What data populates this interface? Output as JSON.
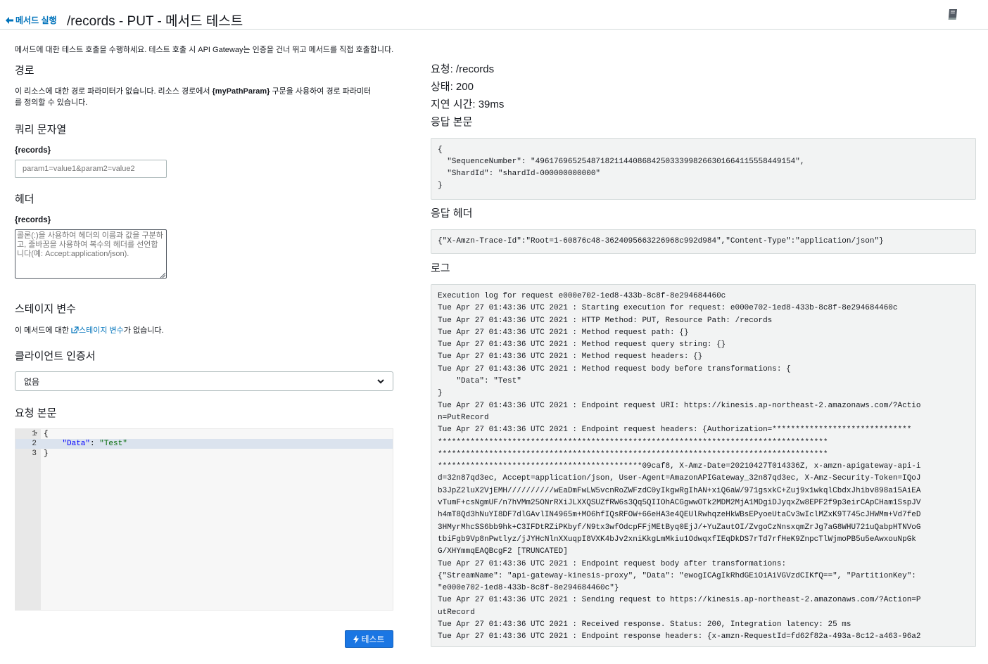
{
  "header": {
    "back_label": "메서드 실행",
    "title": "/records - PUT - 메서드 테스트"
  },
  "left": {
    "intro": "메서드에 대한 테스트 호출을 수행하세요. 테스트 호출 시 API Gateway는 인증을 건너 뛰고 메서드를 직접 호출합니다.",
    "path_heading": "경로",
    "path_text_1": "이 리소스에 대한 경로 파라미터가 없습니다. 리소스 경로에서 ",
    "path_text_bold": "{myPathParam}",
    "path_text_2": " 구문을 사용하여 경로 파라미터",
    "path_text_3": "를 정의할 수 있습니다.",
    "query_heading": "쿼리 문자열",
    "query_label": "{records}",
    "query_placeholder": "param1=value1&param2=value2",
    "headers_heading": "헤더",
    "headers_label": "{records}",
    "headers_placeholder": "콜론(:)을 사용하여 헤더의 이름과 값을 구분하고, 줄바꿈을 사용하여 복수의 헤더를 선언합니다(예: Accept:application/json).",
    "stage_heading": "스테이지 변수",
    "stage_text_1": "이 메서드에 대한 ",
    "stage_link": "스테이지 변수",
    "stage_text_2": "가 없습니다.",
    "cert_heading": "클라이언트 인증서",
    "cert_selected": "없음",
    "body_heading": "요청 본문",
    "editor_lines": [
      {
        "num": "1",
        "text": "{"
      },
      {
        "num": "2",
        "key": "\"Data\"",
        "sep": ": ",
        "val": "\"Test\""
      },
      {
        "num": "3",
        "text": "}"
      }
    ],
    "test_button": "테스트"
  },
  "right": {
    "request": "요청: /records",
    "status": "상태: 200",
    "latency": "지연 시간: 39ms",
    "response_body_heading": "응답 본문",
    "response_body": "{\n  \"SequenceNumber\": \"49617696525487182114408684250333998266301664115558449154\",\n  \"ShardId\": \"shardId-000000000000\"\n}",
    "response_headers_heading": "응답 헤더",
    "response_headers": "{\"X-Amzn-Trace-Id\":\"Root=1-60876c48-3624095663226968c992d984\",\"Content-Type\":\"application/json\"}",
    "logs_heading": "로그",
    "logs": "Execution log for request e000e702-1ed8-433b-8c8f-8e294684460c\nTue Apr 27 01:43:36 UTC 2021 : Starting execution for request: e000e702-1ed8-433b-8c8f-8e294684460c\nTue Apr 27 01:43:36 UTC 2021 : HTTP Method: PUT, Resource Path: /records\nTue Apr 27 01:43:36 UTC 2021 : Method request path: {}\nTue Apr 27 01:43:36 UTC 2021 : Method request query string: {}\nTue Apr 27 01:43:36 UTC 2021 : Method request headers: {}\nTue Apr 27 01:43:36 UTC 2021 : Method request body before transformations: {\n    \"Data\": \"Test\"\n}\nTue Apr 27 01:43:36 UTC 2021 : Endpoint request URI: https://kinesis.ap-northeast-2.amazonaws.com/?Actio\nn=PutRecord\nTue Apr 27 01:43:36 UTC 2021 : Endpoint request headers: {Authorization=******************************\n************************************************************************************\n************************************************************************************\n********************************************09caf8, X-Amz-Date=20210427T014336Z, x-amzn-apigateway-api-i\nd=32n87qd3ec, Accept=application/json, User-Agent=AmazonAPIGateway_32n87qd3ec, X-Amz-Security-Token=IQoJ\nb3JpZ2luX2VjEMH//////////wEaDmFwLW5vcnRoZWFzdC0yIkgwRgIhAN+xiQ6aW/971gsxkC+Zuj9x1wkqlCbdxJhibv898a15AiEA\nvTumF+csNgmUF/n7hVMm25ONrRXiJLXXQSUZfRW6s3Qq5QIIOhACGgwwOTk2MDM2MjA1MDgiDJyqxZw8EPF2f9p3eirCApCHam1SspJV\nh4mT8Qd3hNuYI8DF7dlGAvlIN4965m+MO6hfIQsRFOW+66eHA3e4QEUlRwhqzeHkWBsEPyoeUtaCv3wIclMZxK9T745cJHWMm+Vd7feD\n3HMyrMhcSS6bb9hk+C3IFDtRZiPKbyf/N9tx3wfOdcpFFjMEtByq0EjJ/+YuZautOI/ZvgoCzNnsxqmZrJg7aG8WHU721uQabpHTNVoG\ntbiFgb9Vp8nPwtlyz/jJYHcNlnXXuqpI8VXK4bJv2xniKkgLmMkiu1OdwqxfIEqDkDS7rTd7rfHeK9ZnpcTlWjmoPB5u5eAwxouNpGk\nG/XHYmmqEAQBcgF2 [TRUNCATED]\nTue Apr 27 01:43:36 UTC 2021 : Endpoint request body after transformations:\n{\"StreamName\": \"api-gateway-kinesis-proxy\", \"Data\": \"ewogICAgIkRhdGEiOiAiVGVzdCIKfQ==\", \"PartitionKey\":\n\"e000e702-1ed8-433b-8c8f-8e294684460c\"}\nTue Apr 27 01:43:36 UTC 2021 : Sending request to https://kinesis.ap-northeast-2.amazonaws.com/?Action=P\nutRecord\nTue Apr 27 01:43:36 UTC 2021 : Received response. Status: 200, Integration latency: 25 ms\nTue Apr 27 01:43:36 UTC 2021 : Endpoint response headers: {x-amzn-RequestId=fd62f82a-493a-8c12-a463-96a2"
  },
  "icons": {
    "back": "arrow-left-icon",
    "book": "book-icon",
    "external": "external-link-icon",
    "chevron": "chevron-down-icon",
    "bolt": "lightning-icon"
  },
  "colors": {
    "link": "#0073bb",
    "primary_button": "#1a76e3",
    "code_bg": "#f2f3f3"
  }
}
